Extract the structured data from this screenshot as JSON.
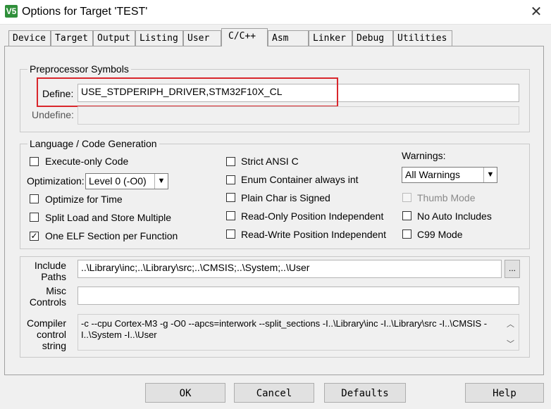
{
  "window": {
    "title": "Options for Target 'TEST'",
    "icon_text": "V5",
    "close_glyph": "✕"
  },
  "tabs": [
    {
      "label": "Device"
    },
    {
      "label": "Target"
    },
    {
      "label": "Output"
    },
    {
      "label": "Listing"
    },
    {
      "label": "User"
    },
    {
      "label": "C/C++"
    },
    {
      "label": "Asm"
    },
    {
      "label": "Linker"
    },
    {
      "label": "Debug"
    },
    {
      "label": "Utilities"
    }
  ],
  "preprocessor": {
    "legend": "Preprocessor Symbols",
    "define_label": "Define:",
    "define_value": "USE_STDPERIPH_DRIVER,STM32F10X_CL",
    "undefine_label": "Undefine:",
    "undefine_value": ""
  },
  "codegen": {
    "legend": "Language / Code Generation",
    "execute_only": "Execute-only Code",
    "optimization_label": "Optimization:",
    "optimization_value": "Level 0 (-O0)",
    "optimize_time": "Optimize for Time",
    "split_load": "Split Load and Store Multiple",
    "one_elf": "One ELF Section per Function",
    "strict_ansi": "Strict ANSI C",
    "enum_container": "Enum Container always int",
    "plain_char": "Plain Char is Signed",
    "ro_pi": "Read-Only Position Independent",
    "rw_pi": "Read-Write Position Independent",
    "warnings_label": "Warnings:",
    "warnings_value": "All Warnings",
    "thumb_mode": "Thumb Mode",
    "no_auto_includes": "No Auto Includes",
    "c99_mode": "C99 Mode",
    "check_glyph": "✓"
  },
  "paths": {
    "include_label_1": "Include",
    "include_label_2": "Paths",
    "include_value": "..\\Library\\inc;..\\Library\\src;..\\CMSIS;..\\System;..\\User",
    "browse_label": "...",
    "misc_label_1": "Misc",
    "misc_label_2": "Controls",
    "misc_value": "",
    "compiler_label_1": "Compiler",
    "compiler_label_2": "control",
    "compiler_label_3": "string",
    "compiler_line_1": "-c --cpu Cortex-M3 -g -O0 --apcs=interwork --split_sections -I..\\Library\\inc -I..\\Library\\src -I..\\CMSIS -",
    "compiler_line_2": "I..\\System -I..\\User",
    "scroll_up": "︿",
    "scroll_down": "﹀"
  },
  "buttons": {
    "ok": "OK",
    "cancel": "Cancel",
    "defaults": "Defaults",
    "help": "Help"
  },
  "colors": {
    "highlight_box": "#d9262c",
    "app_icon": "#2f8f3a"
  }
}
